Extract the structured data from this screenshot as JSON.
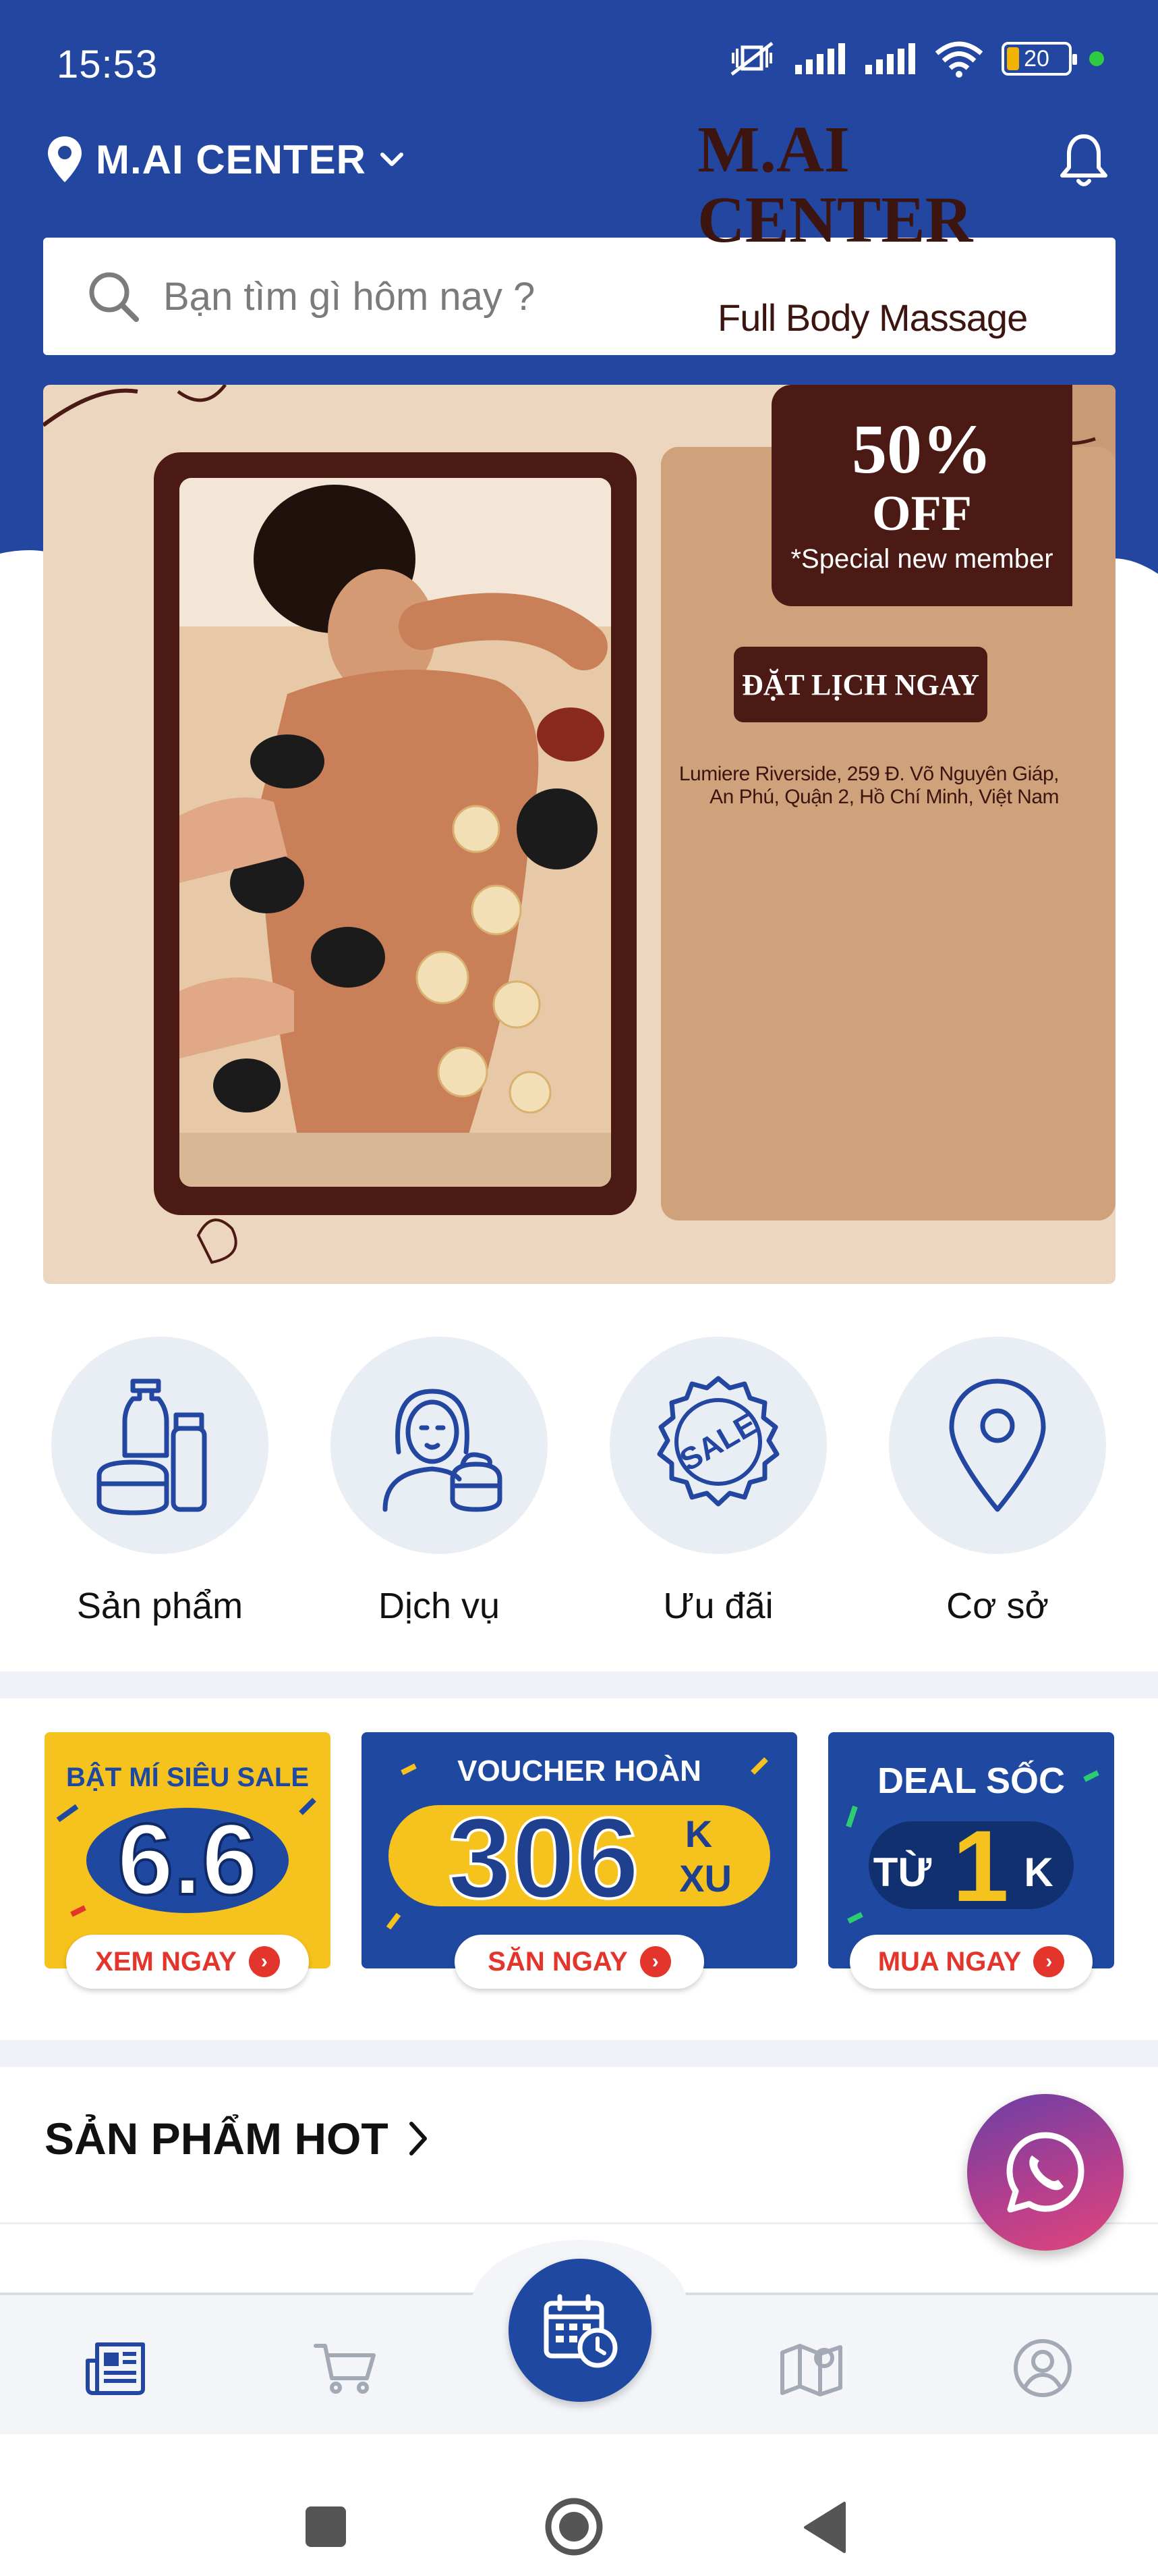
{
  "status_bar": {
    "time": "15:53",
    "battery_level": "20"
  },
  "header": {
    "location_name": "M.AI CENTER",
    "search_placeholder": "Bạn tìm gì hôm nay ?",
    "brand_color": "#2346a0"
  },
  "banner": {
    "brand_line1": "M.AI",
    "brand_line2": "CENTER",
    "subtitle": "Full Body Massage",
    "discount": "50%",
    "off": "OFF",
    "note": "*Special new member",
    "book_button": "ĐẶT LỊCH NGAY",
    "address_line1": "Lumiere Riverside, 259 Đ. Võ Nguyên Giáp,",
    "address_line2": "An Phú, Quận 2, Hồ Chí Minh, Việt Nam"
  },
  "categories": [
    {
      "label": "Sản phẩm",
      "icon": "cosmetics-icon"
    },
    {
      "label": "Dịch vụ",
      "icon": "woman-skincare-icon"
    },
    {
      "label": "Ưu đãi",
      "icon": "sale-badge-icon"
    },
    {
      "label": "Cơ sở",
      "icon": "map-pin-icon"
    }
  ],
  "promos": [
    {
      "top": "BẬT MÍ SIÊU SALE",
      "big": "6.6",
      "cta": "XEM NGAY"
    },
    {
      "top": "VOUCHER HOÀN",
      "big": "306",
      "sup": "K",
      "sub": "XU",
      "cta": "SĂN NGAY"
    },
    {
      "top": "DEAL SỐC",
      "big_prefix": "TỪ",
      "big": "1",
      "suffix": "K",
      "cta": "MUA NGAY"
    }
  ],
  "section": {
    "hot_products_title": "SẢN PHẨM HOT"
  },
  "bottom_nav": [
    {
      "name": "news",
      "icon": "newspaper-icon"
    },
    {
      "name": "cart",
      "icon": "cart-icon"
    },
    {
      "name": "booking",
      "icon": "calendar-clock-icon"
    },
    {
      "name": "map",
      "icon": "map-icon"
    },
    {
      "name": "account",
      "icon": "user-circle-icon"
    }
  ]
}
